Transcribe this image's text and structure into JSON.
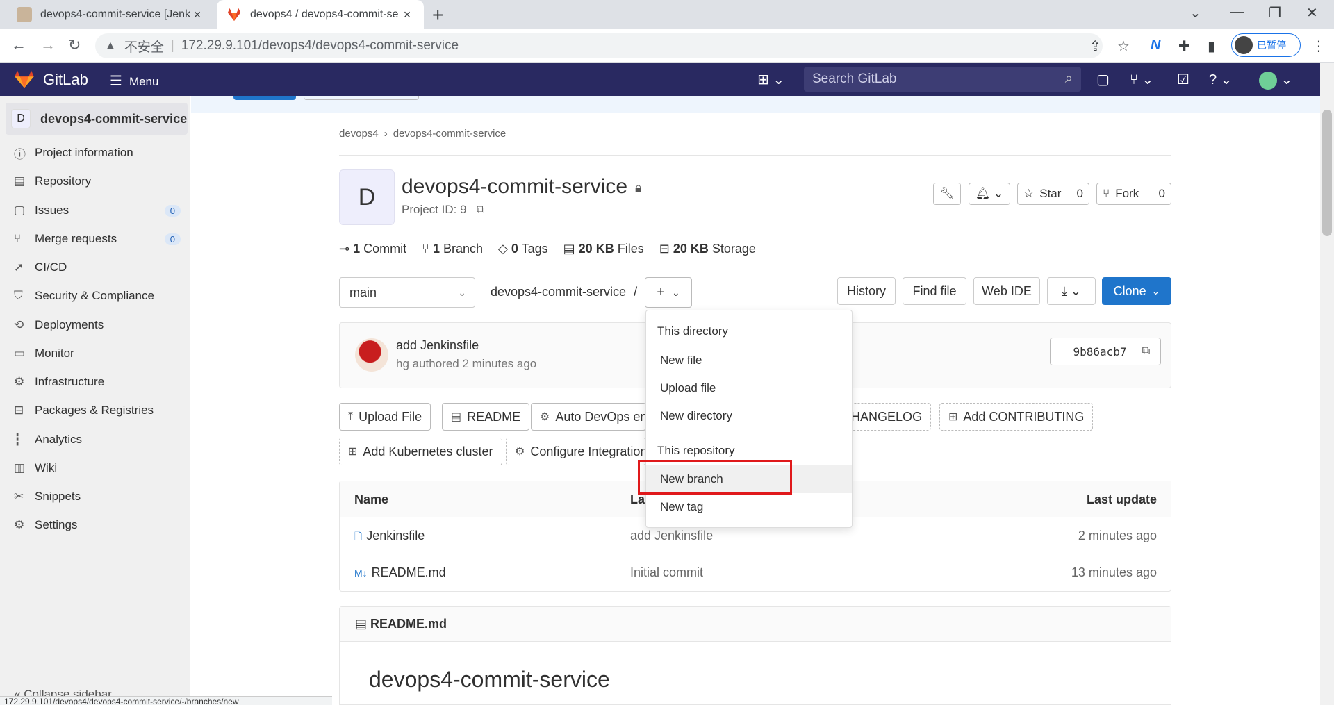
{
  "browser": {
    "tabs": [
      {
        "title": "devops4-commit-service [Jenk"
      },
      {
        "title": "devops4 / devops4-commit-se"
      }
    ],
    "security": "不安全",
    "url_host": "172.29.9.101",
    "url_path": "/devops4/devops4-commit-service",
    "profile_status": "已暂停",
    "status_url": "172.29.9.101/devops4/devops4-commit-service/-/branches/new"
  },
  "topbar": {
    "brand": "GitLab",
    "menu_label": "Menu",
    "search_placeholder": "Search GitLab"
  },
  "sidebar": {
    "project_initial": "D",
    "project_name": "devops4-commit-service",
    "items": [
      {
        "label": "Project information"
      },
      {
        "label": "Repository"
      },
      {
        "label": "Issues",
        "count": "0"
      },
      {
        "label": "Merge requests",
        "count": "0"
      },
      {
        "label": "CI/CD"
      },
      {
        "label": "Security & Compliance"
      },
      {
        "label": "Deployments"
      },
      {
        "label": "Monitor"
      },
      {
        "label": "Infrastructure"
      },
      {
        "label": "Packages & Registries"
      },
      {
        "label": "Analytics"
      },
      {
        "label": "Wiki"
      },
      {
        "label": "Snippets"
      },
      {
        "label": "Settings"
      }
    ],
    "collapse_label": "Collapse sidebar"
  },
  "breadcrumb": {
    "group": "devops4",
    "project": "devops4-commit-service"
  },
  "project": {
    "initial": "D",
    "title": "devops4-commit-service",
    "id_label": "Project ID: 9",
    "star_label": "Star",
    "star_count": "0",
    "fork_label": "Fork",
    "fork_count": "0"
  },
  "stats": {
    "commits_num": "1",
    "commits_label": "Commit",
    "branches_num": "1",
    "branches_label": "Branch",
    "tags_num": "0",
    "tags_label": "Tags",
    "files_num": "20 KB",
    "files_label": "Files",
    "storage_num": "20 KB",
    "storage_label": "Storage"
  },
  "repo_bar": {
    "branch": "main",
    "path": "devops4-commit-service",
    "path_sep": "/",
    "history": "History",
    "find_file": "Find file",
    "web_ide": "Web IDE",
    "clone": "Clone"
  },
  "last_commit": {
    "message": "add Jenkinsfile",
    "author_line": "hg authored 2 minutes ago",
    "sha": "9b86acb7"
  },
  "quick_actions": {
    "upload_file": "Upload File",
    "readme": "README",
    "auto_devops": "Auto DevOps enabled",
    "changelog": "Add CHANGELOG",
    "contributing": "Add CONTRIBUTING",
    "k8s": "Add Kubernetes cluster",
    "integrations": "Configure Integrations"
  },
  "file_table": {
    "headers": {
      "name": "Name",
      "last_commit": "Last commit",
      "last_update": "Last update"
    },
    "rows": [
      {
        "name": "Jenkinsfile",
        "commit": "add Jenkinsfile",
        "updated": "2 minutes ago"
      },
      {
        "name": "README.md",
        "commit": "Initial commit",
        "updated": "13 minutes ago"
      }
    ]
  },
  "readme": {
    "file": "README.md",
    "heading": "devops4-commit-service"
  },
  "dropdown": {
    "section1": "This directory",
    "new_file": "New file",
    "upload_file": "Upload file",
    "new_directory": "New directory",
    "section2": "This repository",
    "new_branch": "New branch",
    "new_tag": "New tag"
  }
}
